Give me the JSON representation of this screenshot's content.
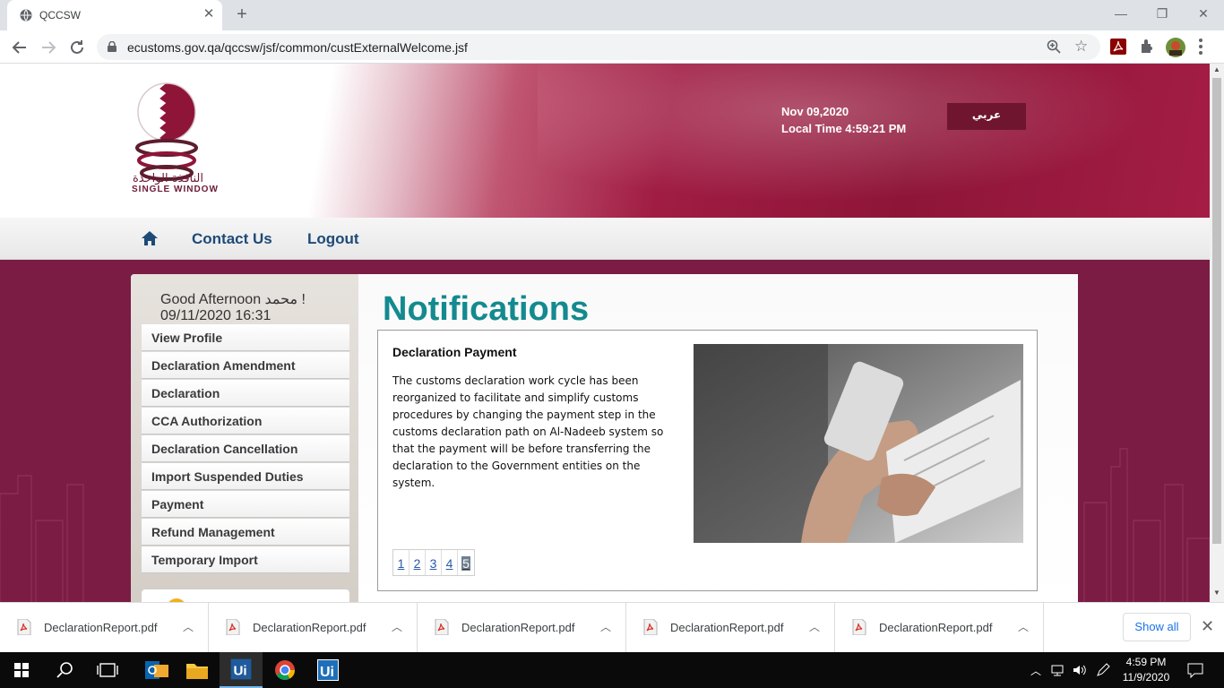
{
  "browser": {
    "tab_title": "QCCSW",
    "url": "ecustoms.gov.qa/qccsw/jsf/common/custExternalWelcome.jsf"
  },
  "header": {
    "logo_arabic": "النافذة الواحدة",
    "logo_english": "SINGLE WINDOW",
    "date": "Nov 09,2020",
    "local_time": "Local Time 4:59:21 PM",
    "language_button": "عربي"
  },
  "navbar": {
    "contact_us": "Contact Us",
    "logout": "Logout"
  },
  "sidebar": {
    "greeting": "Good Afternoon محمد !",
    "datetime": "09/11/2020 16:31",
    "items": [
      {
        "label": "View Profile"
      },
      {
        "label": "Declaration Amendment"
      },
      {
        "label": "Declaration"
      },
      {
        "label": "CCA Authorization"
      },
      {
        "label": "Declaration Cancellation"
      },
      {
        "label": "Import Suspended Duties"
      },
      {
        "label": "Payment"
      },
      {
        "label": "Refund Management"
      },
      {
        "label": "Temporary Import"
      }
    ]
  },
  "notifications": {
    "title": "Notifications",
    "heading": "Declaration Payment",
    "body": "The customs declaration work cycle has been reorganized to facilitate and simplify customs procedures by changing the payment step in the customs declaration path on Al-Nadeeb system so that the payment will be before transferring the declaration to the Government entities on the system.",
    "pages": [
      "1",
      "2",
      "3",
      "4",
      "5"
    ],
    "current_page": "5"
  },
  "downloads": {
    "files": [
      "DeclarationReport.pdf",
      "DeclarationReport.pdf",
      "DeclarationReport.pdf",
      "DeclarationReport.pdf",
      "DeclarationReport.pdf"
    ],
    "show_all": "Show all"
  },
  "taskbar": {
    "time": "4:59 PM",
    "date": "11/9/2020"
  },
  "colors": {
    "brand_maroon": "#8e1538",
    "notification_teal": "#138a8f",
    "nav_link_blue": "#1d4a77"
  }
}
